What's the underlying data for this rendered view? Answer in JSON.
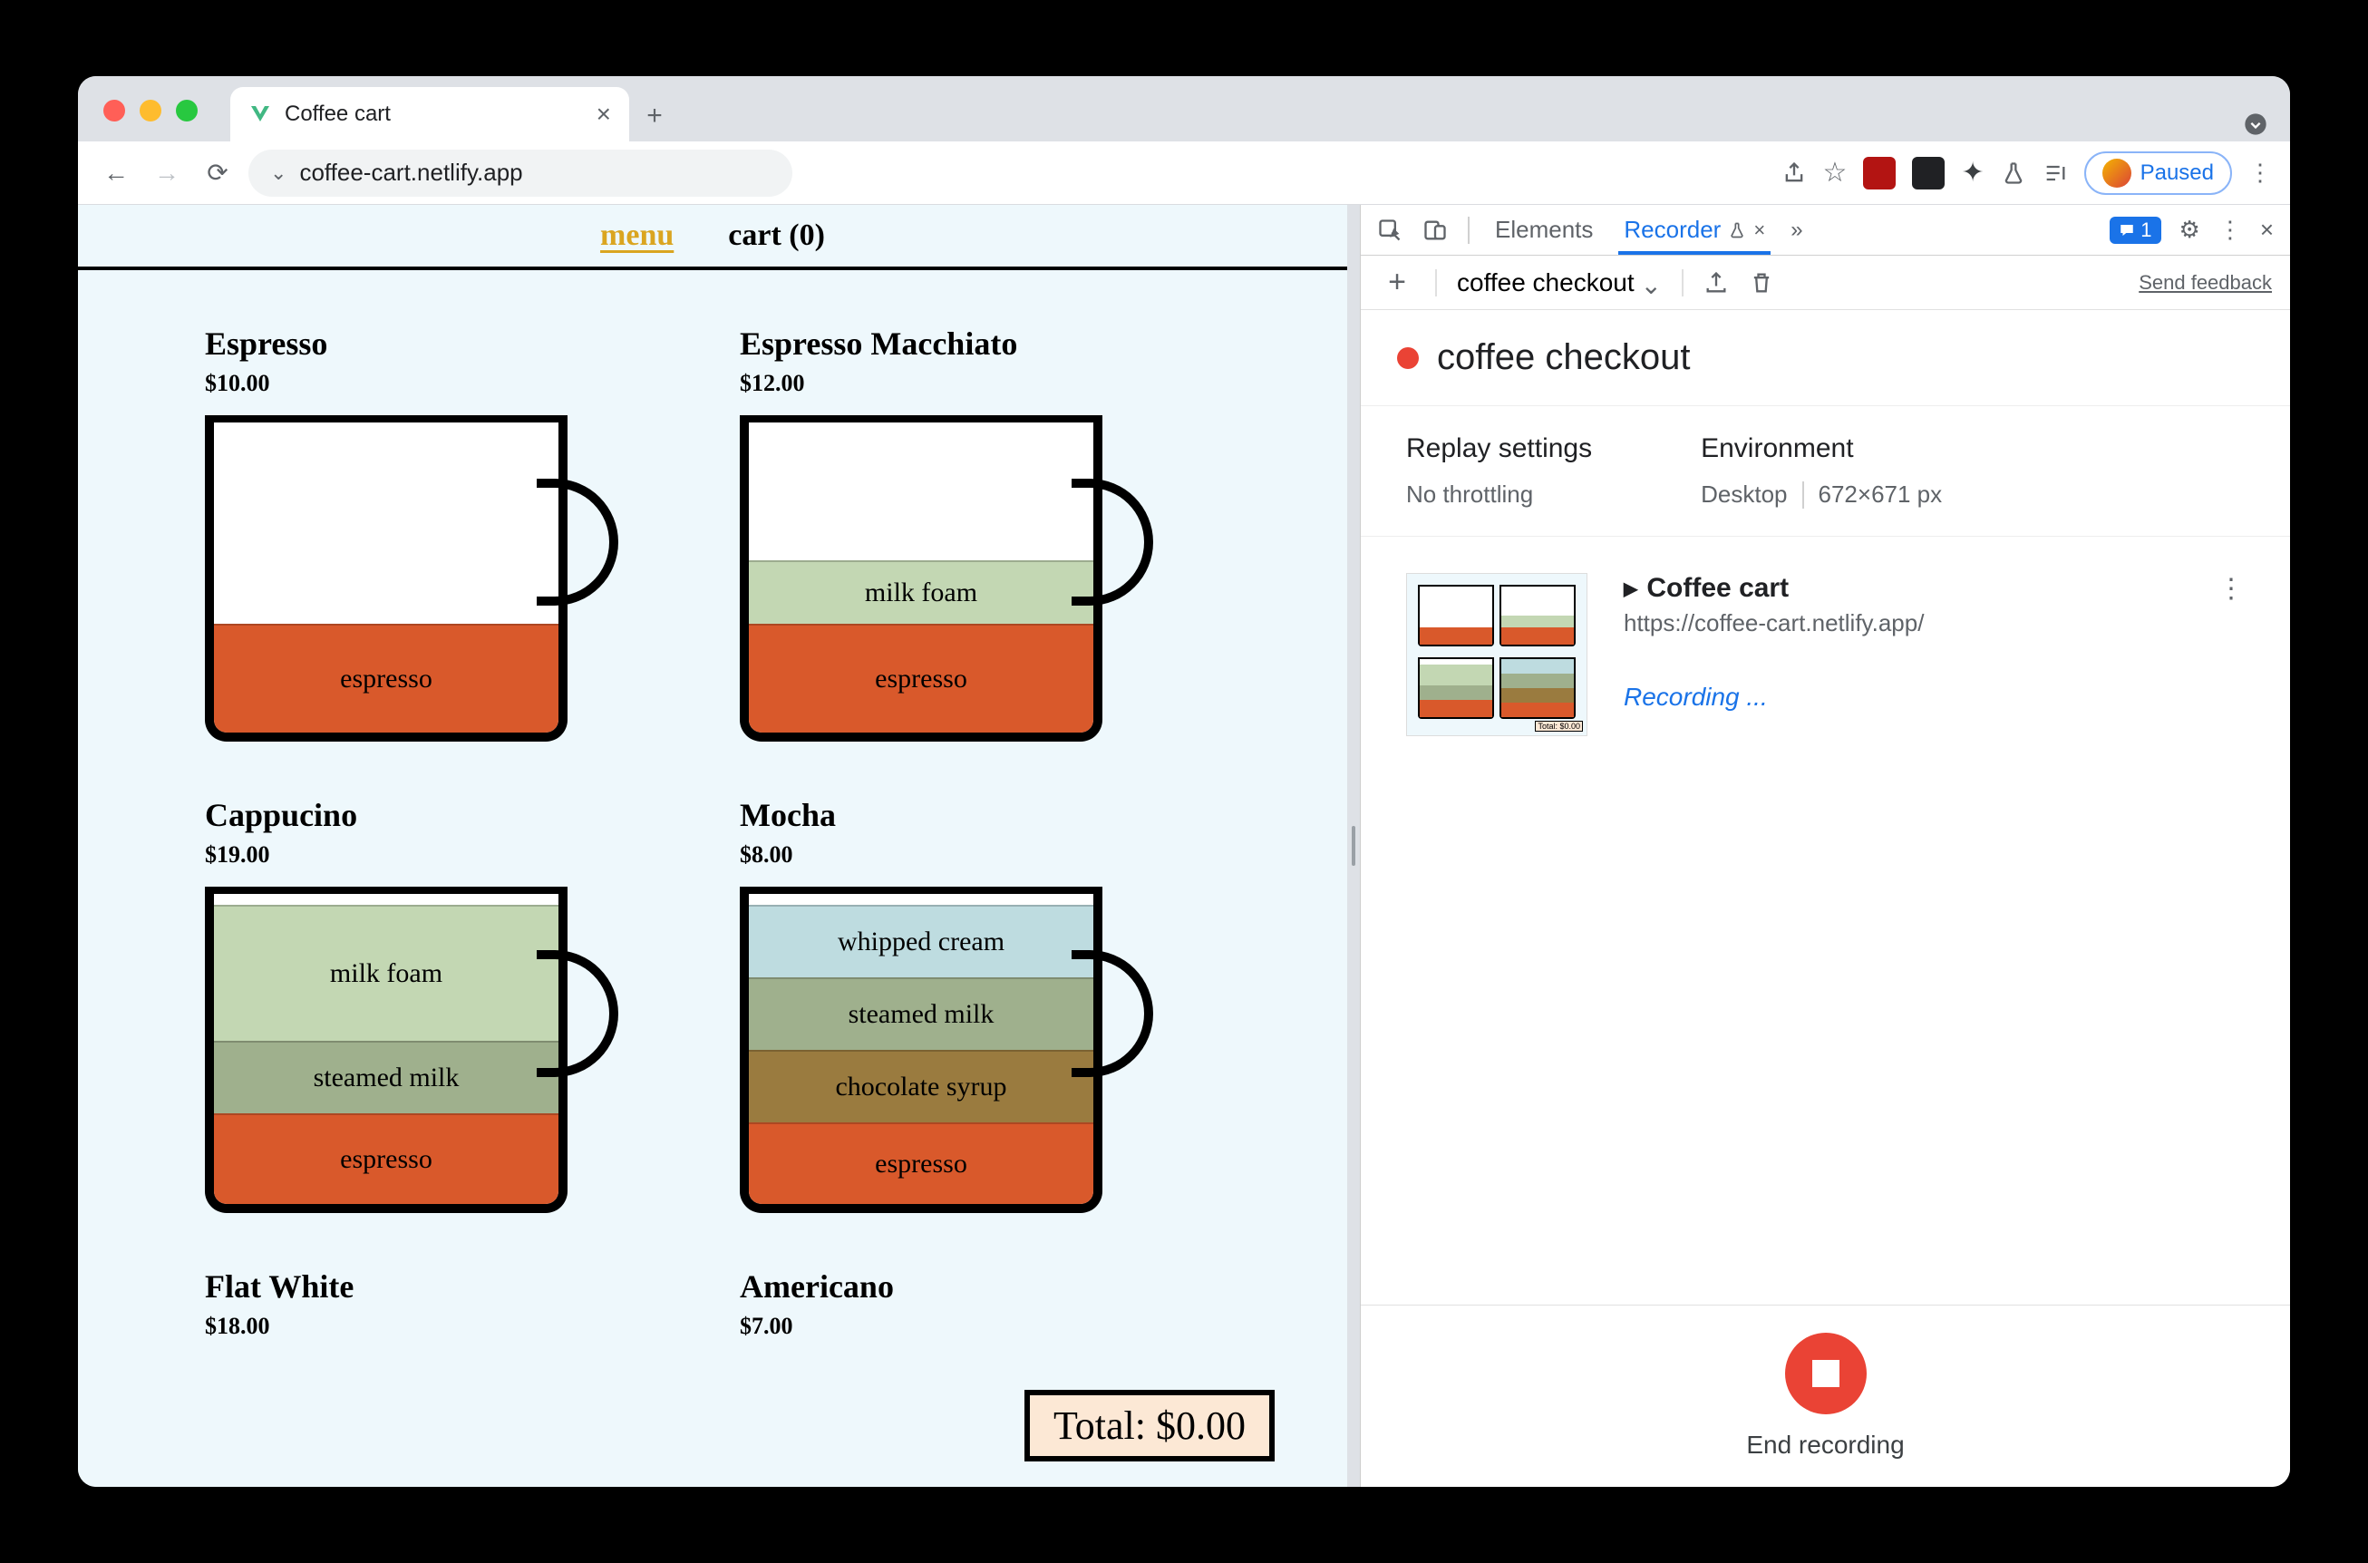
{
  "browser": {
    "tab_title": "Coffee cart",
    "url_display": "coffee-cart.netlify.app",
    "paused_label": "Paused"
  },
  "page": {
    "nav": {
      "menu": "menu",
      "cart": "cart (0)"
    },
    "products": [
      {
        "name": "Espresso",
        "price": "$10.00",
        "layers": [
          {
            "label": "espresso",
            "h": 120,
            "c": "#d9592b"
          }
        ]
      },
      {
        "name": "Espresso Macchiato",
        "price": "$12.00",
        "layers": [
          {
            "label": "milk foam",
            "h": 70,
            "c": "#c3d7b3"
          },
          {
            "label": "espresso",
            "h": 120,
            "c": "#d9592b"
          }
        ]
      },
      {
        "name": "Cappucino",
        "price": "$19.00",
        "layers": [
          {
            "label": "milk foam",
            "h": 150,
            "c": "#c3d7b3"
          },
          {
            "label": "steamed milk",
            "h": 80,
            "c": "#9fb08d"
          },
          {
            "label": "espresso",
            "h": 100,
            "c": "#d9592b"
          }
        ]
      },
      {
        "name": "Mocha",
        "price": "$8.00",
        "layers": [
          {
            "label": "whipped cream",
            "h": 80,
            "c": "#bedce0"
          },
          {
            "label": "steamed milk",
            "h": 80,
            "c": "#9fb08d"
          },
          {
            "label": "chocolate syrup",
            "h": 80,
            "c": "#9a7b3f"
          },
          {
            "label": "espresso",
            "h": 90,
            "c": "#d9592b"
          }
        ]
      },
      {
        "name": "Flat White",
        "price": "$18.00",
        "layers": []
      },
      {
        "name": "Americano",
        "price": "$7.00",
        "layers": []
      }
    ],
    "total_label": "Total: $0.00"
  },
  "devtools": {
    "tabs": {
      "elements": "Elements",
      "recorder": "Recorder"
    },
    "issues_count": "1",
    "recording_name": "coffee checkout",
    "feedback": "Send feedback",
    "title": "coffee checkout",
    "replay": {
      "heading": "Replay settings",
      "value": "No throttling"
    },
    "env": {
      "heading": "Environment",
      "device": "Desktop",
      "size": "672×671 px"
    },
    "step": {
      "title": "Coffee cart",
      "url": "https://coffee-cart.netlify.app/",
      "status": "Recording ..."
    },
    "end_label": "End recording"
  }
}
